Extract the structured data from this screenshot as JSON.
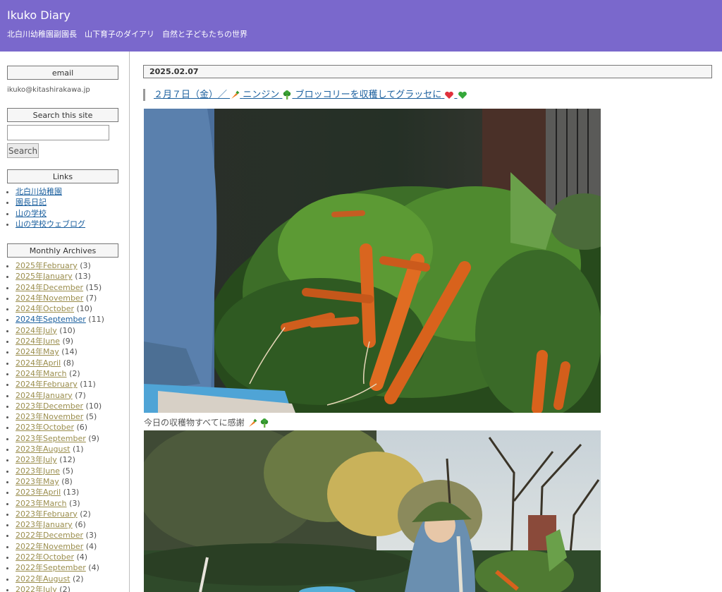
{
  "site": {
    "title": "Ikuko Diary",
    "description": "北白川幼稚園副園長　山下育子のダイアリ　自然と子どもたちの世界"
  },
  "sidebar": {
    "email": {
      "heading": "email",
      "address": "ikuko@kitashirakawa.jp"
    },
    "search": {
      "heading": "Search this site",
      "input_value": "",
      "button_label": "Search"
    },
    "links": {
      "heading": "Links",
      "items": [
        {
          "label": "北白川幼稚園"
        },
        {
          "label": "園長日記"
        },
        {
          "label": "山の学校"
        },
        {
          "label": "山の学校ウェブログ"
        }
      ]
    },
    "archives": {
      "heading": "Monthly Archives",
      "items": [
        {
          "label": "2025年February",
          "count": "(3)"
        },
        {
          "label": "2025年January",
          "count": "(13)"
        },
        {
          "label": "2024年December",
          "count": "(15)"
        },
        {
          "label": "2024年November",
          "count": "(7)"
        },
        {
          "label": "2024年October",
          "count": "(10)"
        },
        {
          "label": "2024年September",
          "count": "(11)"
        },
        {
          "label": "2024年July",
          "count": "(10)"
        },
        {
          "label": "2024年June",
          "count": "(9)"
        },
        {
          "label": "2024年May",
          "count": "(14)"
        },
        {
          "label": "2024年April",
          "count": "(8)"
        },
        {
          "label": "2024年March",
          "count": "(2)"
        },
        {
          "label": "2024年February",
          "count": "(11)"
        },
        {
          "label": "2024年January",
          "count": "(7)"
        },
        {
          "label": "2023年December",
          "count": "(10)"
        },
        {
          "label": "2023年November",
          "count": "(5)"
        },
        {
          "label": "2023年October",
          "count": "(6)"
        },
        {
          "label": "2023年September",
          "count": "(9)"
        },
        {
          "label": "2023年August",
          "count": "(1)"
        },
        {
          "label": "2023年July",
          "count": "(12)"
        },
        {
          "label": "2023年June",
          "count": "(5)"
        },
        {
          "label": "2023年May",
          "count": "(8)"
        },
        {
          "label": "2023年April",
          "count": "(13)"
        },
        {
          "label": "2023年March",
          "count": "(3)"
        },
        {
          "label": "2023年February",
          "count": "(2)"
        },
        {
          "label": "2023年January",
          "count": "(6)"
        },
        {
          "label": "2022年December",
          "count": "(3)"
        },
        {
          "label": "2022年November",
          "count": "(4)"
        },
        {
          "label": "2022年October",
          "count": "(4)"
        },
        {
          "label": "2022年September",
          "count": "(4)"
        },
        {
          "label": "2022年August",
          "count": "(2)"
        },
        {
          "label": "2022年July",
          "count": "(2)"
        }
      ]
    }
  },
  "entry": {
    "date": "2025.02.07",
    "title_part1": "２月７日（金）／",
    "title_part2": "ニンジン",
    "title_part3": "ブロッコリーを収穫してグラッセに",
    "caption": "今日の収穫物すべてに感謝",
    "icons": [
      "carrot-icon",
      "broccoli-icon",
      "heart-icon",
      "green-heart-icon"
    ]
  },
  "colors": {
    "banner": "#7a68cc",
    "link": "#1a5f9e",
    "visited_link": "#9a8d4c"
  }
}
